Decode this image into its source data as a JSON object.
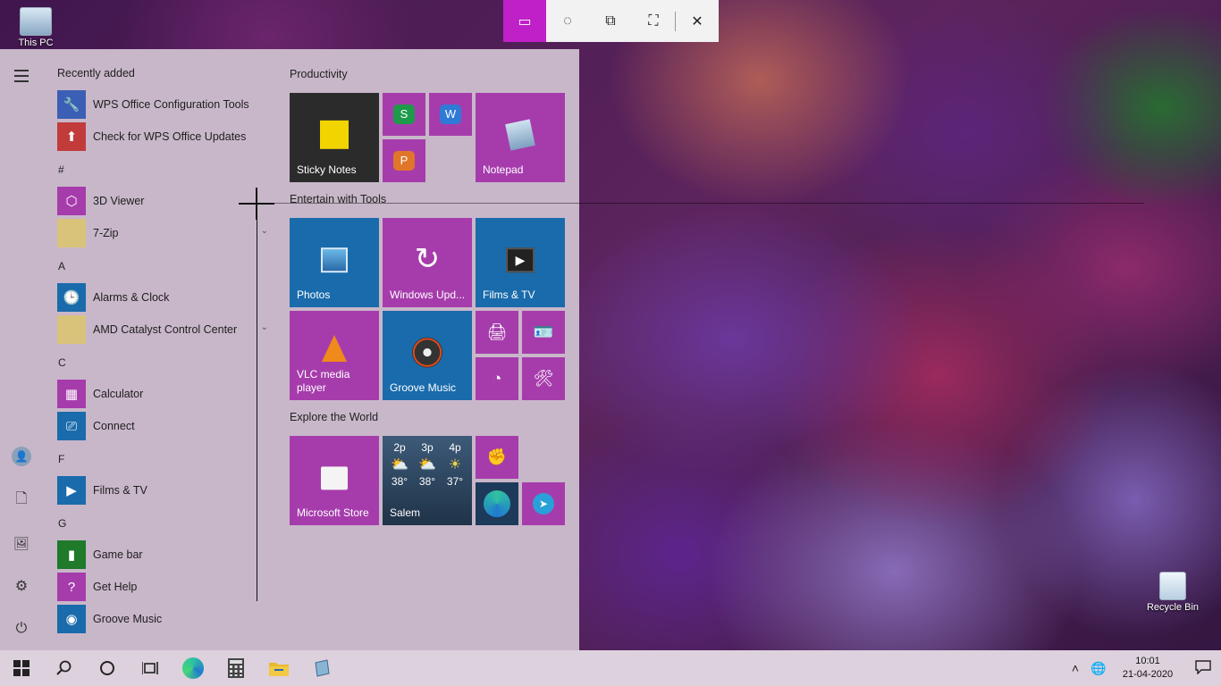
{
  "desktop": {
    "icons": [
      {
        "label": "This PC",
        "icon": "this-pc-icon"
      },
      {
        "label": "Recycle Bin",
        "icon": "recycle-bin-icon"
      }
    ]
  },
  "snip_toolbar": {
    "buttons": [
      {
        "name": "rectangular-snip",
        "glyph": "▭",
        "active": true
      },
      {
        "name": "freeform-snip",
        "glyph": "◌"
      },
      {
        "name": "window-snip",
        "glyph": "⧉"
      },
      {
        "name": "fullscreen-snip",
        "glyph": "⛶"
      },
      {
        "name": "close",
        "glyph": "✕"
      }
    ]
  },
  "start_menu": {
    "rail": {
      "power_glyph": "⏻",
      "settings_glyph": "⚙",
      "pictures_glyph": "🖼",
      "documents_glyph": "🗋",
      "user_glyph": "👤"
    },
    "app_list": {
      "recently_added_title": "Recently added",
      "letters": {
        "hash": "#",
        "a": "A",
        "c": "C",
        "f": "F",
        "g": "G"
      },
      "apps": [
        {
          "label": "WPS Office Configuration Tools",
          "glyph": "🔧",
          "color": "#3b5fb5"
        },
        {
          "label": "Check for WPS Office Updates",
          "glyph": "⬆",
          "color": "#c23b3b"
        },
        {
          "label": "3D Viewer",
          "glyph": "⬡",
          "color": "#a63cac"
        },
        {
          "label": "7-Zip",
          "glyph": "",
          "color": "#d9c37a"
        },
        {
          "label": "Alarms & Clock",
          "glyph": "🕒",
          "color": "#1a6bab"
        },
        {
          "label": "AMD Catalyst Control Center",
          "glyph": "",
          "color": "#d9c37a"
        },
        {
          "label": "Calculator",
          "glyph": "▦",
          "color": "#a63cac"
        },
        {
          "label": "Connect",
          "glyph": "⎚",
          "color": "#1a6bab"
        },
        {
          "label": "Films & TV",
          "glyph": "▶",
          "color": "#1a6bab"
        },
        {
          "label": "Game bar",
          "glyph": "▮",
          "color": "#1f7a2a"
        },
        {
          "label": "Get Help",
          "glyph": "?",
          "color": "#a63cac"
        },
        {
          "label": "Groove Music",
          "glyph": "◉",
          "color": "#1a6bab"
        }
      ]
    },
    "tiles": {
      "productivity_title": "Productivity",
      "entertain_title": "Entertain with Tools",
      "explore_title": "Explore the World",
      "sticky_notes": "Sticky Notes",
      "notepad": "Notepad",
      "photos": "Photos",
      "windows_update": "Windows Upd...",
      "films_tv": "Films & TV",
      "vlc": "VLC media player",
      "groove": "Groove Music",
      "store": "Microsoft Store",
      "weather": {
        "city": "Salem",
        "hours": [
          "2p",
          "3p",
          "4p"
        ],
        "temps": [
          "38°",
          "38°",
          "37°"
        ]
      }
    }
  },
  "taskbar": {
    "time": "10:01",
    "date": "21-04-2020"
  }
}
